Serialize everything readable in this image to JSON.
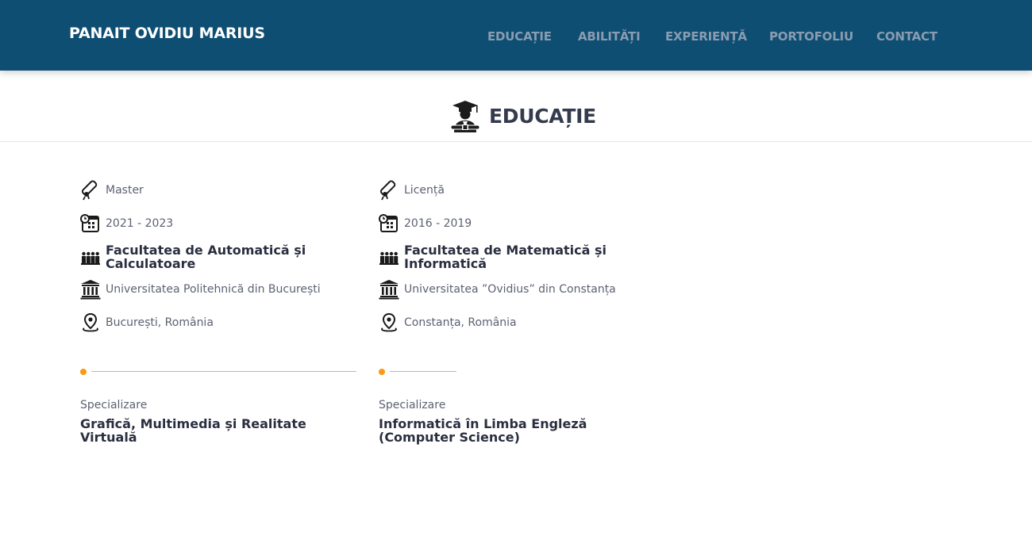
{
  "brand": "PANAIT OVIDIU MARIUS",
  "nav": {
    "education": "EDUCAȚIE",
    "skills": "ABILITĂȚI",
    "experience": "EXPERIENȚĂ",
    "portfolio": "PORTOFOLIU",
    "contact": "CONTACT"
  },
  "section": {
    "title": "EDUCAȚIE",
    "icon": "graduate-icon"
  },
  "education": [
    {
      "degree": "Master",
      "period": "2021 - 2023",
      "faculty": "Facultatea de Automatică și Calculatoare",
      "university": "Universitatea Politehnică din București",
      "location": "București, România",
      "spec_label": "Specializare",
      "specialization": "Grafică, Multimedia și Realitate Virtuală",
      "progress": 1.0
    },
    {
      "degree": "Licență",
      "period": "2016 - 2019",
      "faculty": "Facultatea de Matematică și Informatică",
      "university": "Universitatea ”Ovidius” din Constanța",
      "location": "Constanța, România",
      "spec_label": "Specializare",
      "specialization": "Informatică în Limba Engleză (Computer Science)",
      "progress": 0.25
    }
  ],
  "colors": {
    "navbar": "#0e4e72",
    "accent_dot": "#f79a16",
    "nav_link": "#8a9cb0"
  }
}
